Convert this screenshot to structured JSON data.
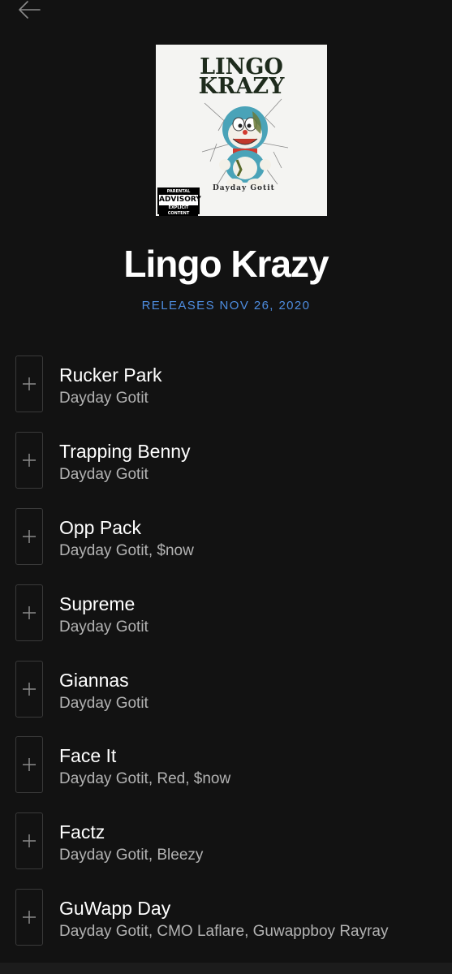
{
  "album": {
    "title": "Lingo Krazy",
    "release_date": "RELEASES NOV 26, 2020",
    "cover": {
      "title_line1": "LINGO",
      "title_line2": "KRAZY",
      "artist": "Dayday Gotit",
      "advisory_top": "PARENTAL",
      "advisory_mid": "ADVISORY",
      "advisory_bottom": "EXPLICIT CONTENT"
    }
  },
  "tracks": [
    {
      "name": "Rucker Park",
      "artists": "Dayday Gotit"
    },
    {
      "name": "Trapping Benny",
      "artists": "Dayday Gotit"
    },
    {
      "name": "Opp Pack",
      "artists": "Dayday Gotit, $now"
    },
    {
      "name": "Supreme",
      "artists": "Dayday Gotit"
    },
    {
      "name": "Giannas",
      "artists": "Dayday Gotit"
    },
    {
      "name": "Face It",
      "artists": "Dayday Gotit, Red, $now"
    },
    {
      "name": "Factz",
      "artists": "Dayday Gotit, Bleezy"
    },
    {
      "name": "GuWapp Day",
      "artists": "Dayday Gotit, CMO Laflare, Guwappboy Rayray"
    }
  ],
  "colors": {
    "background": "#121212",
    "accent": "#4e8de0",
    "secondary_text": "#b3b3b3"
  },
  "icons": {
    "back": "back-arrow-icon",
    "add": "plus-icon"
  }
}
